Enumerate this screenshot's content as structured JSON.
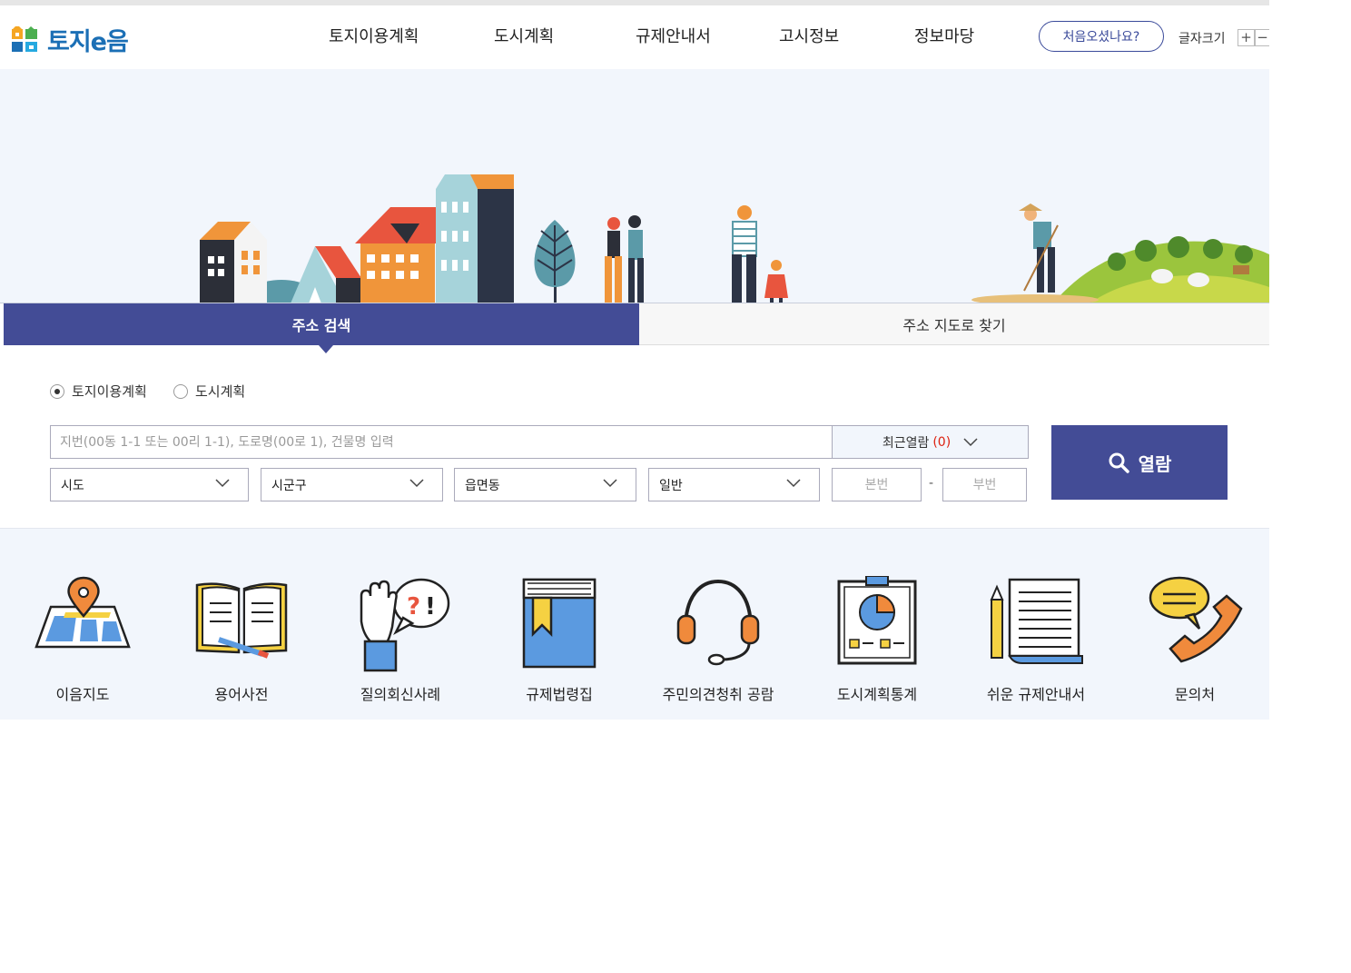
{
  "header": {
    "logo_text": "토지e음",
    "nav": [
      "토지이용계획",
      "도시계획",
      "규제안내서",
      "고시정보",
      "정보마당"
    ],
    "first_visit": "처음오셨나요?",
    "font_size_label": "글자크기",
    "font_plus": "+",
    "font_minus": "−"
  },
  "tabs": {
    "address_search": "주소 검색",
    "map_search": "주소 지도로 찾기"
  },
  "search": {
    "radio_land": "토지이용계획",
    "radio_city": "도시계획",
    "input_placeholder": "지번(00동 1-1 또는 00리 1-1), 도로명(00로 1), 건물명 입력",
    "recent_label": "최근열람",
    "recent_count": "(0)",
    "open_button": "열람",
    "select_sido": "시도",
    "select_sigungu": "시군구",
    "select_eup": "읍면동",
    "select_type": "일반",
    "main_no_placeholder": "본번",
    "dash": "-",
    "sub_no_placeholder": "부번"
  },
  "quick_menu": [
    {
      "label": "이음지도",
      "icon": "map-pin-icon"
    },
    {
      "label": "용어사전",
      "icon": "open-book-icon"
    },
    {
      "label": "질의회신사례",
      "icon": "raised-hand-question-icon"
    },
    {
      "label": "규제법령집",
      "icon": "law-book-icon"
    },
    {
      "label": "주민의견청취 공람",
      "icon": "headset-icon"
    },
    {
      "label": "도시계획통계",
      "icon": "statistics-board-icon"
    },
    {
      "label": "쉬운 규제안내서",
      "icon": "document-pencil-icon"
    },
    {
      "label": "문의처",
      "icon": "phone-chat-icon"
    }
  ],
  "colors": {
    "primary": "#434c96",
    "logo_blue": "#1b6fb5",
    "hero_bg": "#f2f6fc",
    "recent_count": "#dd2211"
  }
}
